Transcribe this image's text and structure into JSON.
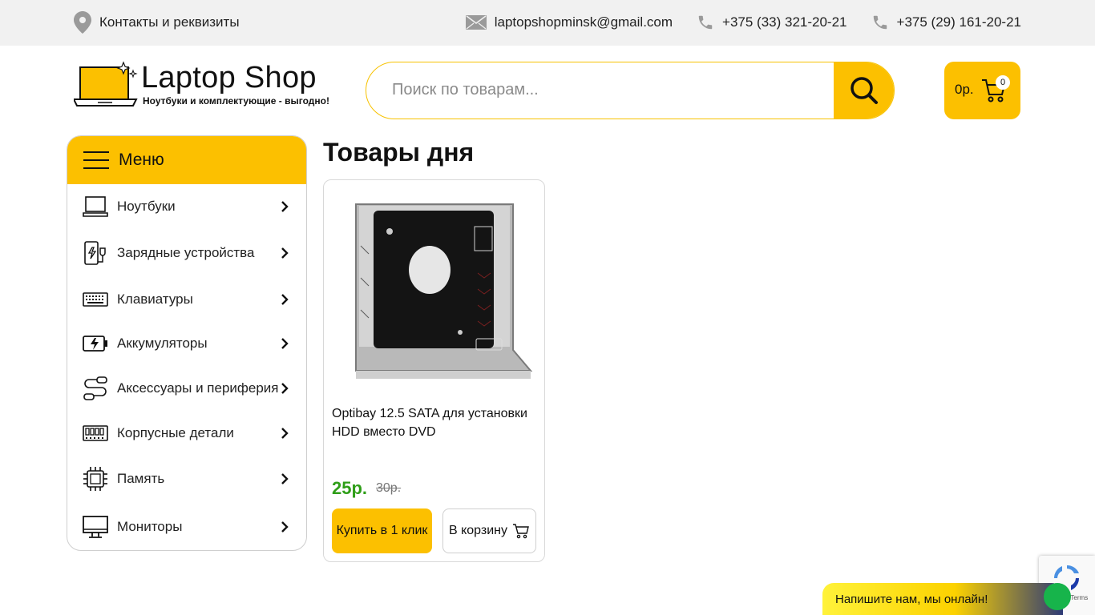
{
  "topbar": {
    "contacts_label": "Контакты и реквизиты",
    "email": "laptopshopminsk@gmail.com",
    "phone1": "+375 (33) 321-20-21",
    "phone2": "+375 (29) 161-20-21"
  },
  "header": {
    "logo_title": "Laptop Shop",
    "logo_subtitle": "Ноутбуки и комплектующие - выгодно!",
    "search_placeholder": "Поиск по товарам...",
    "cart_sum": "0р.",
    "cart_count": "0"
  },
  "menu": {
    "title": "Меню",
    "items": [
      {
        "label": "Ноутбуки",
        "icon": "laptop-icon"
      },
      {
        "label": "Зарядные устройства",
        "icon": "charger-icon"
      },
      {
        "label": "Клавиатуры",
        "icon": "keyboard-icon"
      },
      {
        "label": "Аккумуляторы",
        "icon": "battery-icon"
      },
      {
        "label": "Аксессуары и периферия",
        "icon": "cable-icon"
      },
      {
        "label": "Корпусные детали",
        "icon": "case-parts-icon"
      },
      {
        "label": "Память",
        "icon": "memory-chip-icon"
      },
      {
        "label": "Мониторы",
        "icon": "monitor-icon"
      }
    ]
  },
  "content": {
    "section_title": "Товары дня",
    "product": {
      "name": "Optibay 12.5 SATA для установки HDD вместо DVD",
      "price": "25р.",
      "old_price": "30р.",
      "buy_one_click": "Купить в 1 клик",
      "add_to_cart": "В корзину"
    }
  },
  "chat": {
    "label": "Напишите нам, мы онлайн!"
  },
  "recaptcha": {
    "terms": "acy · Terms"
  },
  "colors": {
    "accent": "#fcc000",
    "price_green": "#2f9e18"
  }
}
